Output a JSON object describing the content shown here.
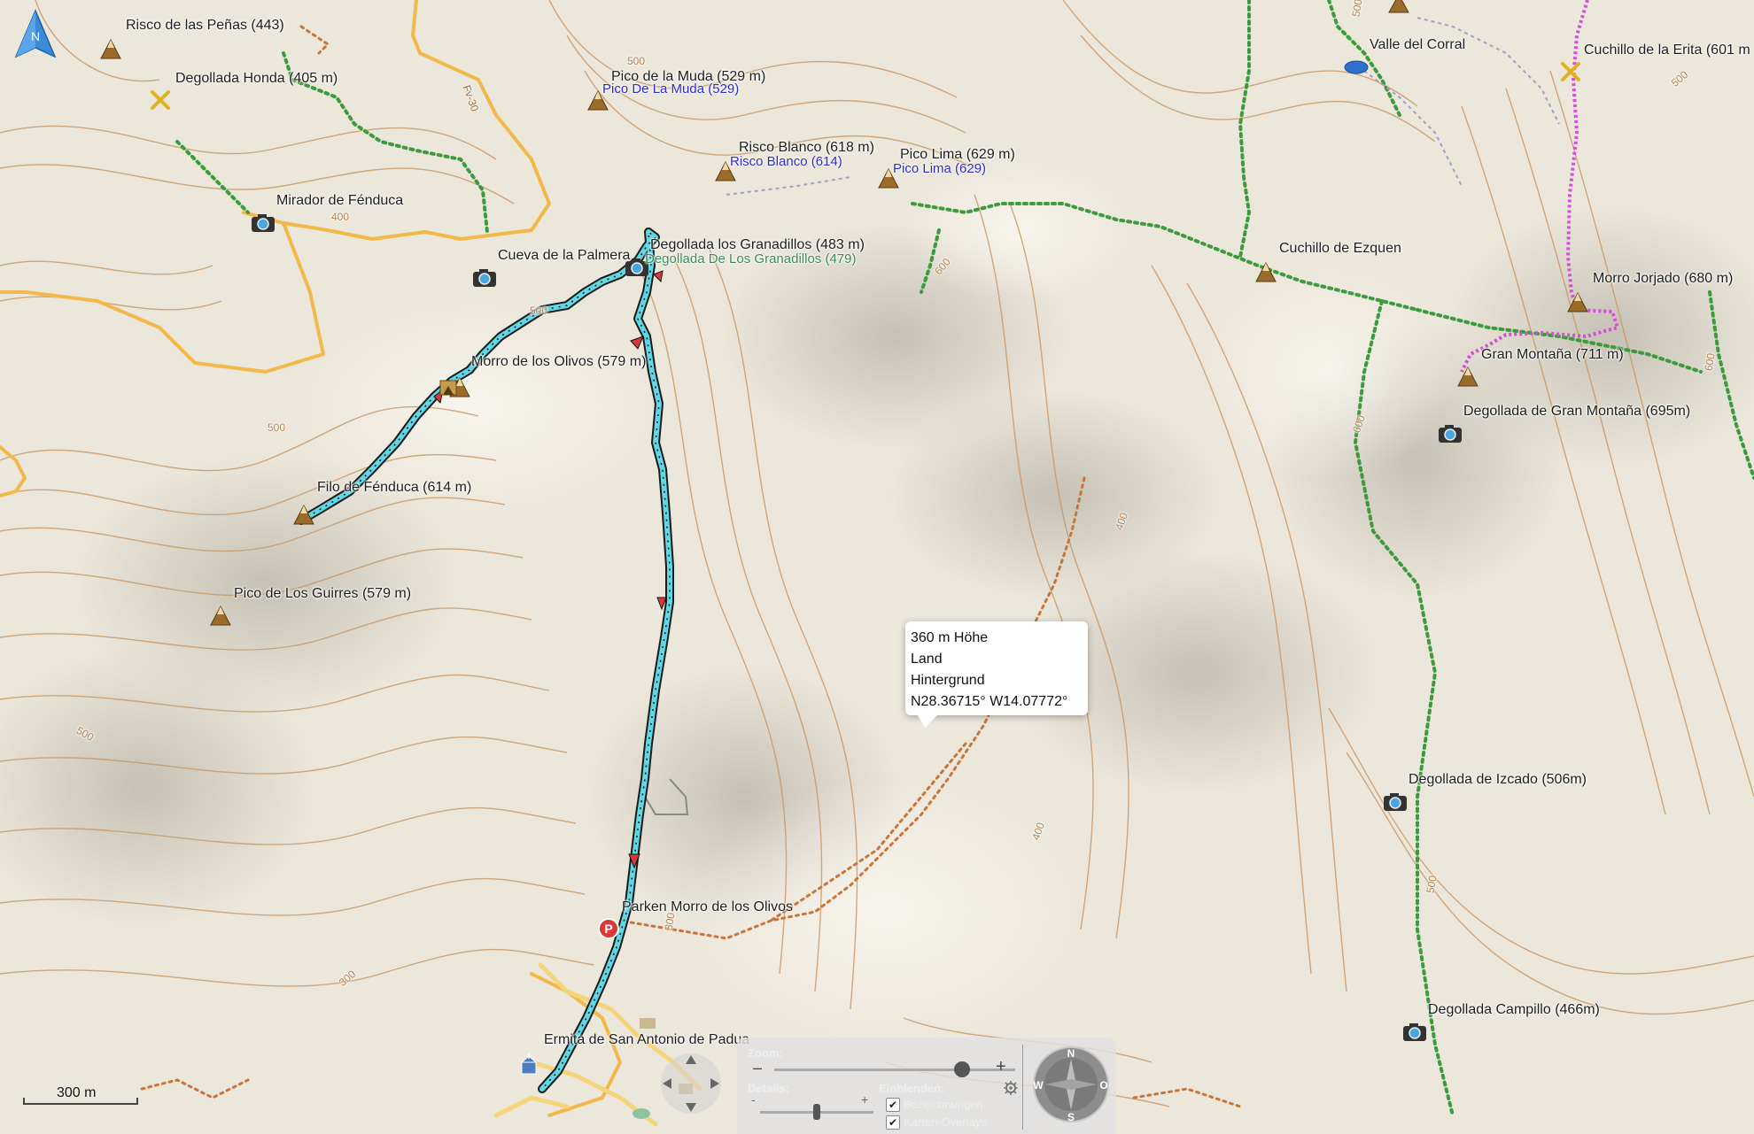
{
  "map": {
    "labels": [
      {
        "id": "risco-penas",
        "text": "Risco de las Peñas (443)"
      },
      {
        "id": "degollada-honda",
        "text": "Degollada Honda (405 m)"
      },
      {
        "id": "pico-muda",
        "text": "Pico de la Muda (529 m)"
      },
      {
        "id": "pico-muda-sub",
        "text": "Pico De La Muda (529)"
      },
      {
        "id": "risco-blanco",
        "text": "Risco Blanco (618 m)"
      },
      {
        "id": "risco-blanco-sub",
        "text": "Risco Blanco (614)"
      },
      {
        "id": "pico-lima",
        "text": "Pico Lima (629 m)"
      },
      {
        "id": "pico-lima-sub",
        "text": "Pico Lima (629)"
      },
      {
        "id": "valle-corral",
        "text": "Valle del Corral"
      },
      {
        "id": "cuchillo-erita",
        "text": "Cuchillo de la Erita (601 m"
      },
      {
        "id": "mirador-fenduca",
        "text": "Mirador de Fénduca"
      },
      {
        "id": "cueva-palmera",
        "text": "Cueva de la Palmera"
      },
      {
        "id": "degollada-granadillos",
        "text": "Degollada los Granadillos (483 m)"
      },
      {
        "id": "degollada-granadillos-sub",
        "text": "Degollada De Los Granadillos (479)"
      },
      {
        "id": "cuchillo-ezquen",
        "text": "Cuchillo de Ezquen"
      },
      {
        "id": "morro-jorjado",
        "text": "Morro Jorjado (680 m)"
      },
      {
        "id": "gran-montana",
        "text": "Gran Montaña (711 m)"
      },
      {
        "id": "degollada-gran-montana",
        "text": "Degollada de Gran Montaña (695m)"
      },
      {
        "id": "morro-olivos",
        "text": "Morro de los Olivos (579 m)"
      },
      {
        "id": "filo-fenduca",
        "text": "Filo de Fénduca (614 m)"
      },
      {
        "id": "pico-guirres",
        "text": "Pico de Los Guirres (579 m)"
      },
      {
        "id": "degollada-izcado",
        "text": "Degollada de Izcado (506m)"
      },
      {
        "id": "parken-olivos",
        "text": "Parken Morro de los Olivos"
      },
      {
        "id": "degollada-campillo",
        "text": "Degollada Campillo (466m)"
      },
      {
        "id": "ermita",
        "text": "Ermita de San Antonio de Padua"
      }
    ],
    "road_label": "Fv-30",
    "contour_numbers": [
      "500",
      "400",
      "500",
      "500",
      "500",
      "600",
      "400",
      "600",
      "500",
      "500",
      "400",
      "300",
      "300",
      "600",
      "500"
    ]
  },
  "popup": {
    "elevation": "360 m Höhe",
    "type": "Land",
    "layer": "Hintergrund",
    "coords": "N28.36715° W14.07772°"
  },
  "scale_bar": {
    "label": "300 m"
  },
  "north_arrow": {
    "letter": "N"
  },
  "controls": {
    "zoom_label": "Zoom:",
    "zoom_minus": "–",
    "zoom_plus": "+",
    "details_label": "Details:",
    "details_minus": "-",
    "details_plus": "+",
    "show_label": "Einblenden:",
    "options": [
      {
        "label": "Bezeichnungen",
        "checked": true
      },
      {
        "label": "Karten-Overlays",
        "checked": true
      }
    ],
    "zoom_level": 0.8,
    "details_level": 0.5
  },
  "compass": {
    "n": "N",
    "s": "S",
    "w": "W",
    "o": "O"
  },
  "colors": {
    "background": "#ece7db",
    "contour": "#c89560",
    "road": "#f2b84a",
    "track": "#5fd7e4",
    "trail_green": "#3d9a3d",
    "trail_magenta": "#d24fd6",
    "trail_orange": "#c9753a"
  }
}
